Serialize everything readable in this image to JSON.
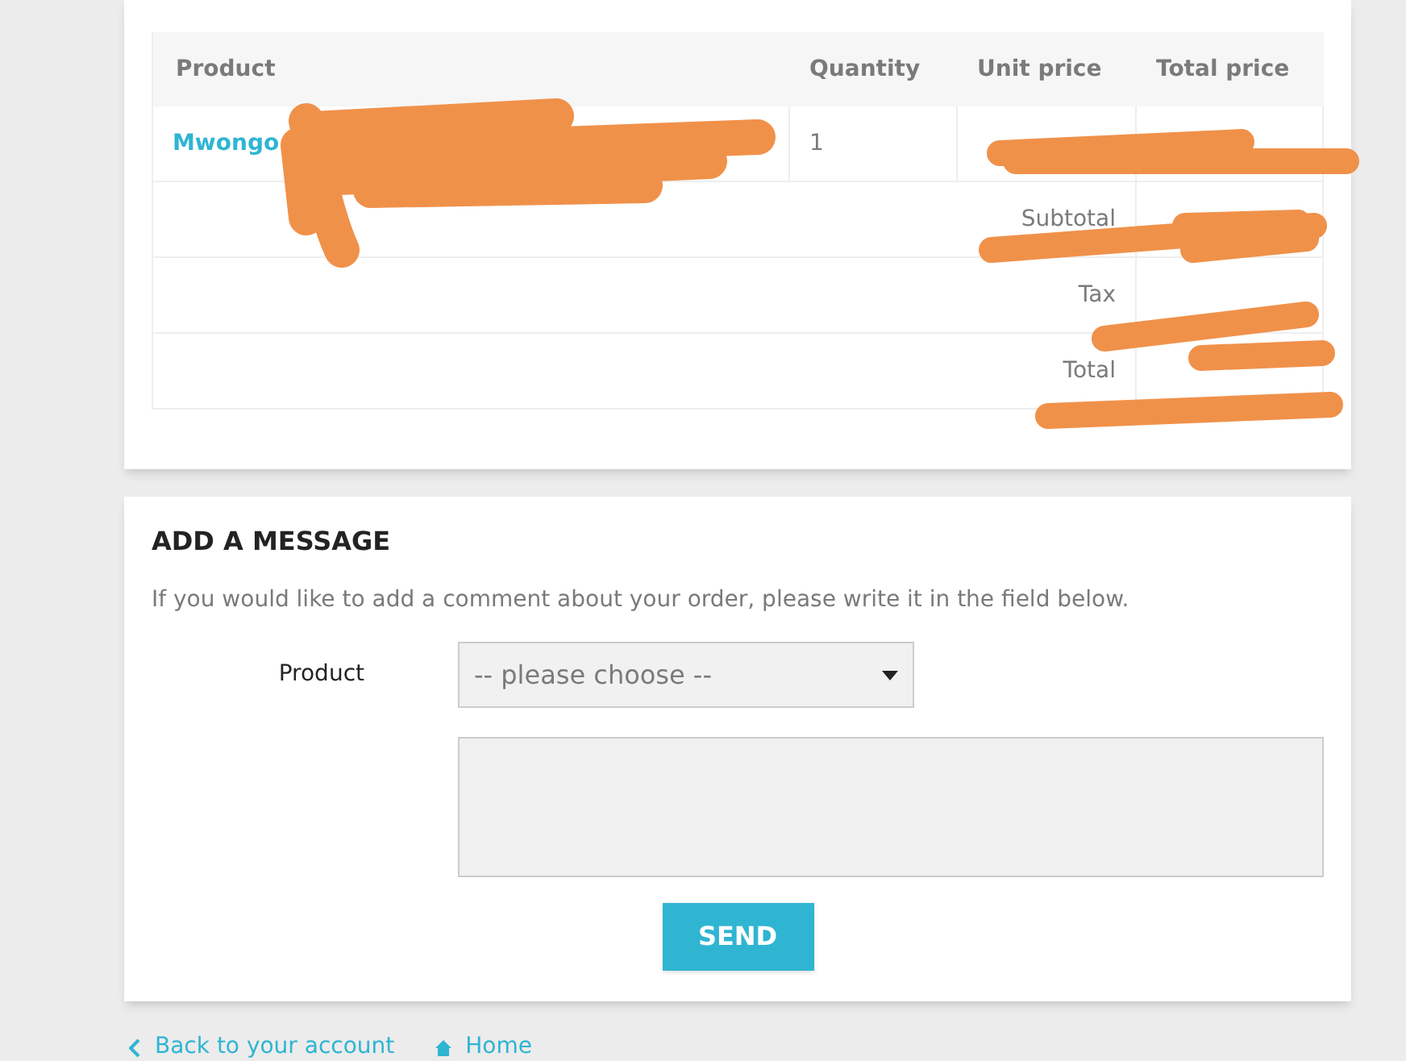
{
  "order_table": {
    "columns": [
      "Product",
      "Quantity",
      "Unit price",
      "Total price"
    ],
    "rows": [
      {
        "product": "Mwongo",
        "quantity": "1"
      }
    ],
    "totals": [
      {
        "label": "Subtotal"
      },
      {
        "label": "Tax"
      },
      {
        "label": "Total"
      }
    ]
  },
  "message": {
    "title": "ADD A MESSAGE",
    "intro": "If you would like to add a comment about your order, please write it in the field below.",
    "product_label": "Product",
    "product_select": {
      "placeholder": "-- please choose --"
    },
    "send": "SEND"
  },
  "footer_links": [
    {
      "label": "Back to your account",
      "kind": "back"
    },
    {
      "label": "Home",
      "kind": "home"
    }
  ]
}
